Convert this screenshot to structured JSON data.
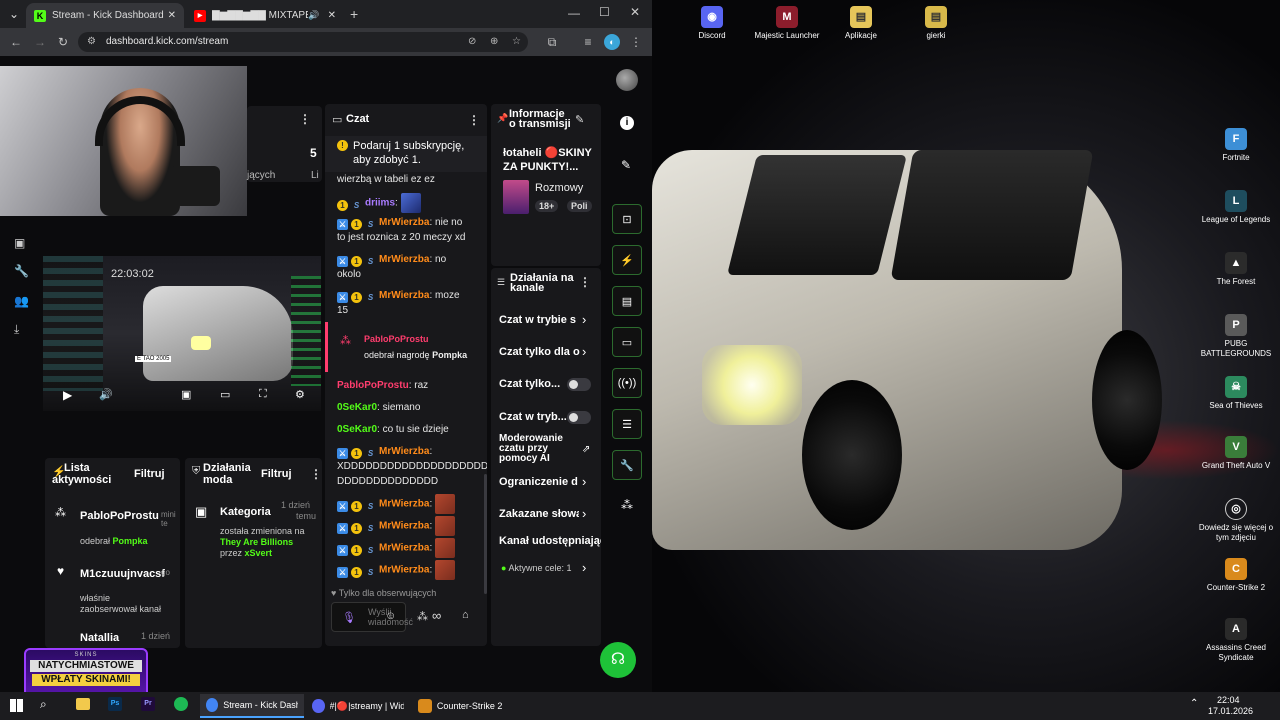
{
  "browser": {
    "tabs": [
      {
        "label": "Stream - Kick Dashboard",
        "favicon": "K"
      },
      {
        "label": "▇▆▇▇▆▇▇ MIXTAPE ("
      }
    ],
    "new_tab": "+",
    "url": "dashboard.kick.com/stream"
  },
  "left_panel": {
    "stat_value": "5",
    "stat_label": "jących",
    "stat_label2": "Li"
  },
  "preview": {
    "timestamp": "22:03:02",
    "plate": "E TAO 2005"
  },
  "activity": {
    "title_line1": "Lista",
    "title_line2": "aktywności",
    "filter": "Filtruj",
    "items": [
      {
        "user": "PabloPoProstu",
        "time": "mini te",
        "text": "odebrał",
        "reward": "Pompka"
      },
      {
        "user": "M1czuuujnvacsf",
        "time": "go",
        "text1": "właśnie",
        "text2": "zaobserwował kanał"
      },
      {
        "user": "Natallia",
        "time": "1 dzień"
      }
    ]
  },
  "mod_actions": {
    "title_line1": "Działania",
    "title_line2": "moda",
    "filter": "Filtruj",
    "item_label": "Kategoria",
    "item_time_line1": "1 dzień",
    "item_time_line2": "temu",
    "text1": "została zmieniona na",
    "category": "They Are Billions",
    "by": "przez",
    "user": "xSvert"
  },
  "chat": {
    "title": "Czat",
    "pinned_line1": "Podaruj 1 subskrypcję,",
    "pinned_line2": "aby zdobyć 1.",
    "messages": [
      {
        "user": "",
        "text": "wierzbą w tabeli ez ez"
      },
      {
        "user": "driims",
        "text": ""
      },
      {
        "user": "MrWierzba",
        "text": "nie no",
        "text2": "to jest roznica z 20 meczy xd"
      },
      {
        "user": "MrWierzba",
        "text": "no",
        "text2": "okolo"
      },
      {
        "user": "MrWierzba",
        "text": "moze",
        "text2": "15"
      },
      {
        "user": "PabloPoProstu",
        "text": "odebrał nagrodę",
        "reward": "Pompka"
      },
      {
        "user": "PabloPoProstu",
        "text": "raz"
      },
      {
        "user": "0SeKar0",
        "text": "siemano"
      },
      {
        "user": "0SeKar0",
        "text": "co tu sie dzieje"
      },
      {
        "user": "MrWierzba",
        "text": "",
        "text2": "XDDDDDDDDDDDDDDDDDDDD",
        "text3": "DDDDDDDDDDDDDD"
      },
      {
        "user": "MrWierzba",
        "text": ""
      },
      {
        "user": "MrWierzba",
        "text": ""
      },
      {
        "user": "MrWierzba",
        "text": ""
      },
      {
        "user": "MrWierzba",
        "text": ""
      }
    ],
    "followers_only": "Tylko dla obserwujących",
    "input_placeholder": "Wyślij wiadomość"
  },
  "stream_info": {
    "title_line1": "Informacje",
    "title_line2": "o transmisji",
    "stream_title_line1": "łotaheli 🔴SKINY",
    "stream_title_line2": "ZA PUNKTY!...",
    "category": "Rozmowy",
    "tag1": "18+",
    "tag2": "Poli"
  },
  "channel_actions": {
    "title_line1": "Działania na",
    "title_line2": "kanale",
    "items": [
      {
        "label": "Czat w trybie s"
      },
      {
        "label": "Czat tylko dla o"
      },
      {
        "label": "Czat tylko..."
      },
      {
        "label": "Czat w tryb..."
      },
      {
        "label_line1": "Moderowanie",
        "label_line2": "czatu przy",
        "label_line3": "pomocy AI"
      },
      {
        "label": "Ograniczenie d"
      },
      {
        "label": "Zakazane słowa"
      },
      {
        "label": "Kanał udostępniając"
      },
      {
        "label": "Aktywne cele: 1"
      }
    ]
  },
  "overlay": {
    "line1": "NATYCHMIASTOWE",
    "line2": "WPŁATY SKINAMI!",
    "brand": "SKINS"
  },
  "desktop_icons": [
    {
      "label": "Discord"
    },
    {
      "label": "Majestic Launcher"
    },
    {
      "label": "Aplikacje"
    },
    {
      "label": "gierki"
    },
    {
      "label": "Fortnite"
    },
    {
      "label": "League of Legends"
    },
    {
      "label": "The Forest"
    },
    {
      "label": "PUBG BATTLEGROUNDS"
    },
    {
      "label": "Sea of Thieves"
    },
    {
      "label": "Grand Theft Auto V"
    },
    {
      "label": "Dowiedz się więcej o tym zdjęciu"
    },
    {
      "label": "Counter-Strike 2"
    },
    {
      "label": "Assassins Creed Syndicate"
    }
  ],
  "taskbar": {
    "items": [
      {
        "label": "Stream - Kick Dash..."
      },
      {
        "label": "#|🔴|streamy | Wid..."
      },
      {
        "label": "Counter-Strike 2"
      }
    ],
    "time": "22:04",
    "date": "17.01.2026"
  },
  "colors": {
    "kick_green": "#53fc18",
    "panel": "#18181b"
  }
}
